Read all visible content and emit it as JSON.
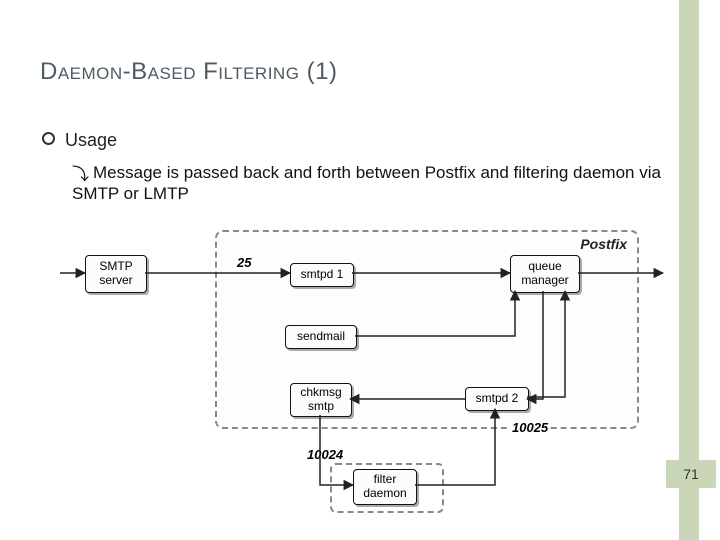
{
  "title": "Daemon-Based Filtering (1)",
  "page_number": "71",
  "usage_label": "Usage",
  "sub_bullet": "Message is passed back and forth between Postfix and filtering daemon via SMTP or LMTP",
  "diagram": {
    "postfix_label": "Postfix",
    "nodes": {
      "smtp_server": "SMTP\nserver",
      "smtpd1": "smtpd 1",
      "queue_manager": "queue\nmanager",
      "sendmail": "sendmail",
      "chkmsg": "chkmsg\nsmtp",
      "smtpd2": "smtpd 2",
      "filter_daemon": "filter\ndaemon"
    },
    "ports": {
      "in": "25",
      "filter_in": "10024",
      "filter_out": "10025"
    }
  }
}
